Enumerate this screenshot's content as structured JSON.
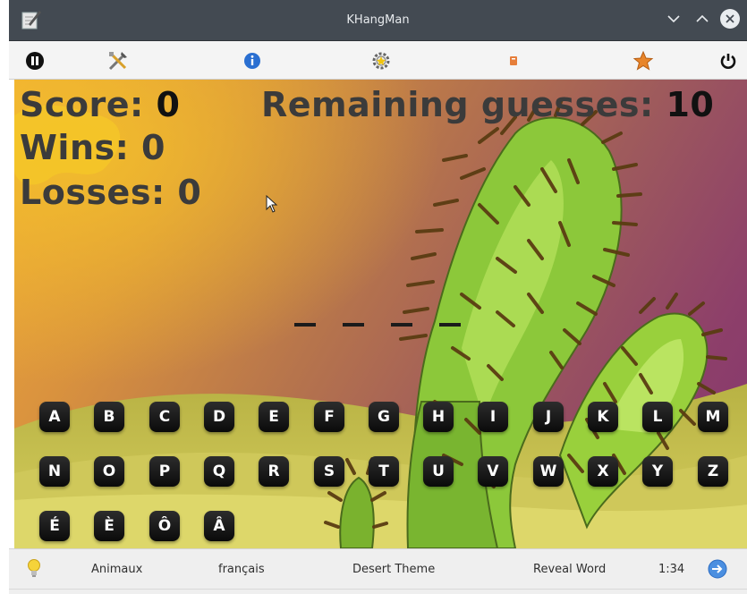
{
  "window": {
    "title": "KHangMan",
    "app_icon": "pencil-paper-icon",
    "buttons": [
      "minimize-icon",
      "maximize-icon",
      "close-icon"
    ]
  },
  "toolbar": {
    "items": [
      {
        "icon": "pause-icon"
      },
      {
        "icon": "tools-icon"
      },
      {
        "icon": "info-icon"
      },
      {
        "icon": "gear-star-icon"
      },
      {
        "icon": "book-icon"
      },
      {
        "icon": "star-icon"
      },
      {
        "icon": "power-icon"
      }
    ]
  },
  "game": {
    "score_label": "Score:",
    "score": "0",
    "wins_label": "Wins:",
    "wins": "0",
    "losses_label": "Losses:",
    "losses": "0",
    "remaining_label": "Remaining guesses:",
    "remaining": "10",
    "word_blanks": 4,
    "letters": [
      "A",
      "B",
      "C",
      "D",
      "E",
      "F",
      "G",
      "H",
      "I",
      "J",
      "K",
      "L",
      "M",
      "N",
      "O",
      "P",
      "Q",
      "R",
      "S",
      "T",
      "U",
      "V",
      "W",
      "X",
      "Y",
      "Z",
      "É",
      "È",
      "Ô",
      "Â"
    ]
  },
  "statusbar": {
    "hint_icon": "lightbulb-icon",
    "category": "Animaux",
    "language": "français",
    "theme": "Desert Theme",
    "reveal": "Reveal Word",
    "time": "1:34",
    "next_icon": "arrow-right-icon"
  },
  "colors": {
    "titlebar": "#434a52",
    "letter_button": "#111111",
    "cactus": "#8fcf3a"
  }
}
